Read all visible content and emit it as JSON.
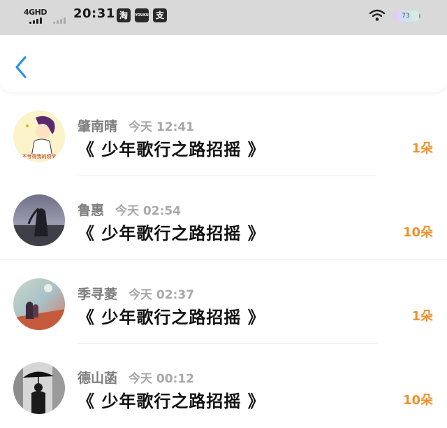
{
  "status_bar": {
    "network": "4GHD",
    "time": "20:31",
    "apps": [
      {
        "icon": "taobao-icon",
        "glyph": "淘"
      },
      {
        "icon": "youku-icon",
        "glyph": "YOUKU"
      },
      {
        "icon": "alipay-icon",
        "glyph": "支"
      }
    ],
    "battery": "73"
  },
  "nav": {
    "back_icon": "chevron-left-icon",
    "accent": "#2b8fe8"
  },
  "records": [
    {
      "name": "肇南晴",
      "time": "今天 12:41",
      "title": "《 少年歌行之路招摇 》",
      "count": "1朵"
    },
    {
      "name": "鲁惠",
      "time": "今天 02:54",
      "title": "《 少年歌行之路招摇 》",
      "count": "10朵"
    },
    {
      "name": "季寻菱",
      "time": "今天 02:37",
      "title": "《 少年歌行之路招摇 》",
      "count": "1朵"
    },
    {
      "name": "德山菡",
      "time": "今天 00:12",
      "title": "《 少年歌行之路招摇 》",
      "count": "10朵"
    }
  ],
  "colors": {
    "count": "#f0912f",
    "status_bar_bg": "#d9d9d9"
  }
}
